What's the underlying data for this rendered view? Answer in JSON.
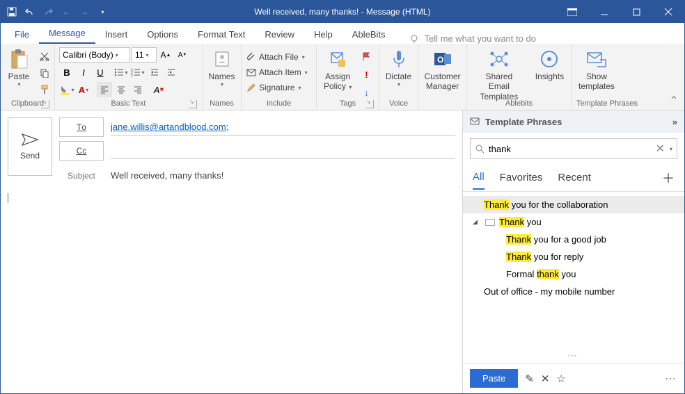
{
  "title": "Well received, many thanks!  -  Message (HTML)",
  "menubar": {
    "file": "File",
    "message": "Message",
    "insert": "Insert",
    "options": "Options",
    "format": "Format Text",
    "review": "Review",
    "help": "Help",
    "ablebits": "AbleBits",
    "tellme": "Tell me what you want to do"
  },
  "ribbon": {
    "clipboard": {
      "label": "Clipboard",
      "paste": "Paste"
    },
    "basictext": {
      "label": "Basic Text",
      "font": "Calibri (Body)",
      "size": "11"
    },
    "names": {
      "label": "Names",
      "names_btn": "Names"
    },
    "include": {
      "label": "Include",
      "attach_file": "Attach File",
      "attach_item": "Attach Item",
      "signature": "Signature"
    },
    "tags": {
      "label": "Tags",
      "assign": "Assign",
      "policy": "Policy"
    },
    "voice": {
      "label": "Voice",
      "dictate": "Dictate"
    },
    "customer": {
      "label1": "Customer",
      "label2": "Manager"
    },
    "ablebits": {
      "label": "Ablebits",
      "shared1": "Shared Email",
      "shared2": "Templates",
      "insights": "Insights"
    },
    "templates": {
      "label": "Template Phrases",
      "show1": "Show",
      "show2": "templates"
    }
  },
  "compose": {
    "send": "Send",
    "to_label": "To",
    "cc_label": "Cc",
    "subject_label": "Subject",
    "to_value": "jane.willis@artandblood.com;",
    "cc_value": "",
    "subject_value": "Well received, many thanks!"
  },
  "pane": {
    "title": "Template Phrases",
    "search_value": "thank",
    "tabs": {
      "all": "All",
      "fav": "Favorites",
      "recent": "Recent"
    },
    "items": [
      {
        "pre": "",
        "hl": "Thank",
        "post": " you for the collaboration"
      },
      {
        "pre": "",
        "hl": "Thank",
        "post": " you"
      },
      {
        "pre": "",
        "hl": "Thank",
        "post": " you for a good job"
      },
      {
        "pre": "",
        "hl": "Thank",
        "post": " you for reply"
      },
      {
        "pre": "Formal ",
        "hl": "thank",
        "post": " you"
      }
    ],
    "out_of_office": "Out of office - my mobile number",
    "paste": "Paste"
  }
}
